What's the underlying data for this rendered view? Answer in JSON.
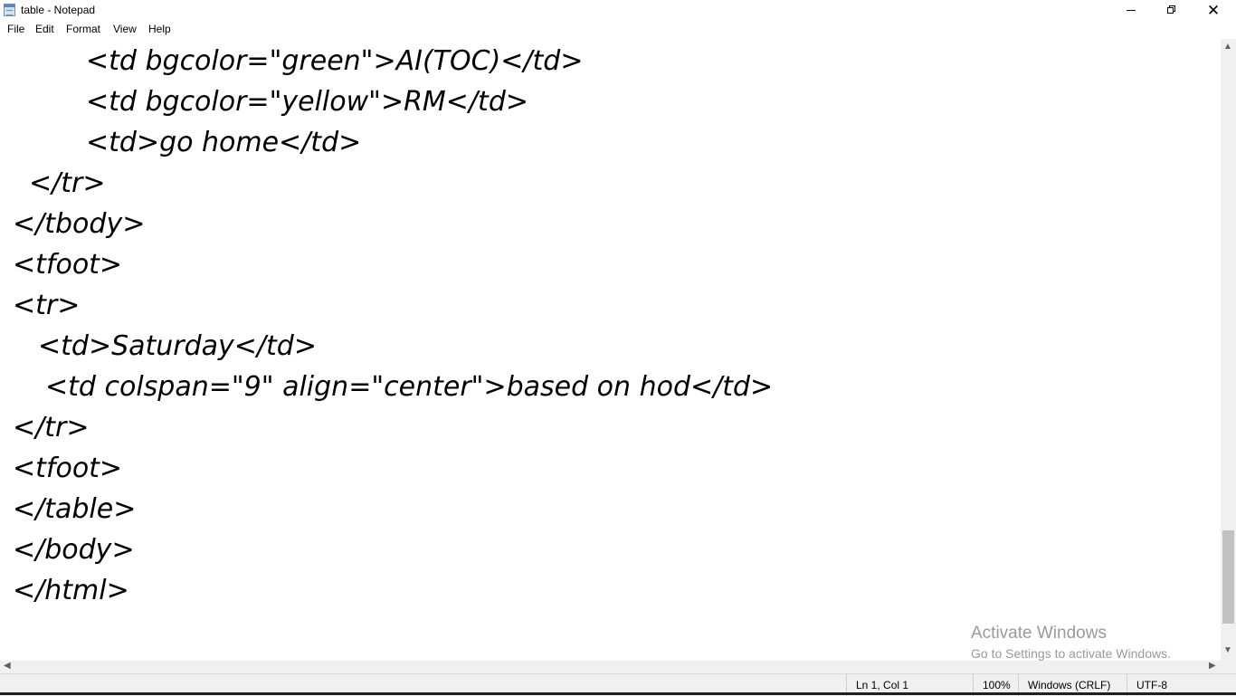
{
  "window": {
    "title": "table - Notepad",
    "minimize_icon": "minimize-icon",
    "restore_icon": "restore-icon",
    "close_icon": "close-icon",
    "close_glyph": "✕"
  },
  "menu": {
    "items": [
      "File",
      "Edit",
      "Format",
      "View",
      "Help"
    ]
  },
  "editor": {
    "lines": [
      "<td bgcolor=\"green\">AI(TOC)</td>",
      "<td bgcolor=\"yellow\">RM</td>",
      "<td>go home</td>",
      "</tr>",
      "</tbody>",
      "<tfoot>",
      "<tr>",
      "<td>Saturday</td>",
      "<td colspan=\"9\" align=\"center\">based on hod</td>",
      "</tr>",
      "<tfoot>",
      "</table>",
      "</body>",
      "</html>"
    ]
  },
  "watermark": {
    "title": "Activate Windows",
    "subtitle": "Go to Settings to activate Windows."
  },
  "statusbar": {
    "position": "Ln 1, Col 1",
    "zoom": "100%",
    "line_ending": "Windows (CRLF)",
    "encoding": "UTF-8"
  },
  "scrollbars": {
    "up_arrow": "▲",
    "down_arrow": "▼",
    "left_arrow": "◀",
    "right_arrow": "▶"
  }
}
